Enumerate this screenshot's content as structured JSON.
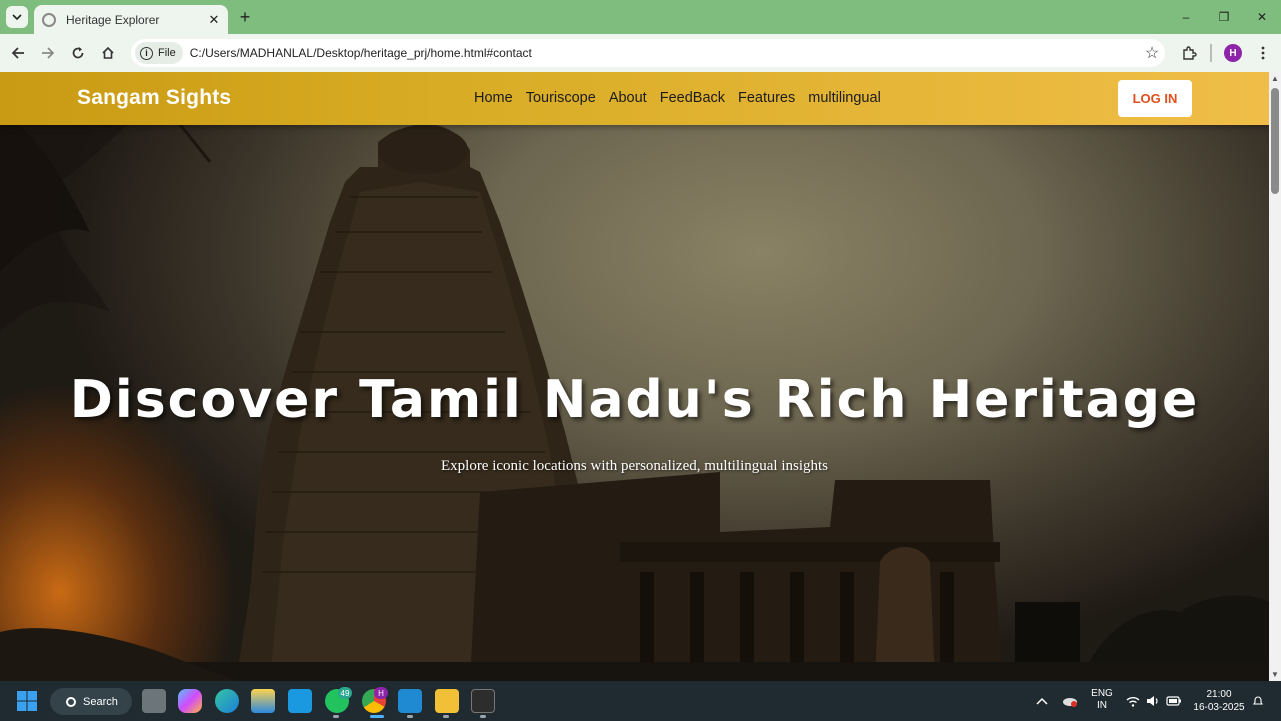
{
  "browser": {
    "tab_title": "Heritage Explorer",
    "tab_close": "✕",
    "new_tab": "+",
    "url_chip": "File",
    "url": "C:/Users/MADHANLAL/Desktop/heritage_prj/home.html#contact",
    "profile_initial": "H",
    "window_controls": {
      "minimize": "–",
      "maximize": "❐",
      "close": "✕"
    }
  },
  "site": {
    "brand": "Sangam Sights",
    "nav": [
      "Home",
      "Touriscope",
      "About",
      "FeedBack",
      "Features",
      "multilingual"
    ],
    "login_label": "LOG IN",
    "hero_title": "Discover Tamil Nadu's Rich Heritage",
    "hero_subtitle": "Explore iconic locations with personalized, multilingual insights"
  },
  "taskbar": {
    "search_label": "Search",
    "whatsapp_badge": "49",
    "chrome_badge": "H",
    "lang_line1": "ENG",
    "lang_line2": "IN",
    "time": "21:00",
    "date": "16-03-2025"
  },
  "colors": {
    "nav_gradient_start": "#c99a13",
    "nav_gradient_end": "#f0be48",
    "login_text": "#e0501e",
    "chrome_frame": "#7fbd7f",
    "taskbar": "#1f2b30"
  }
}
